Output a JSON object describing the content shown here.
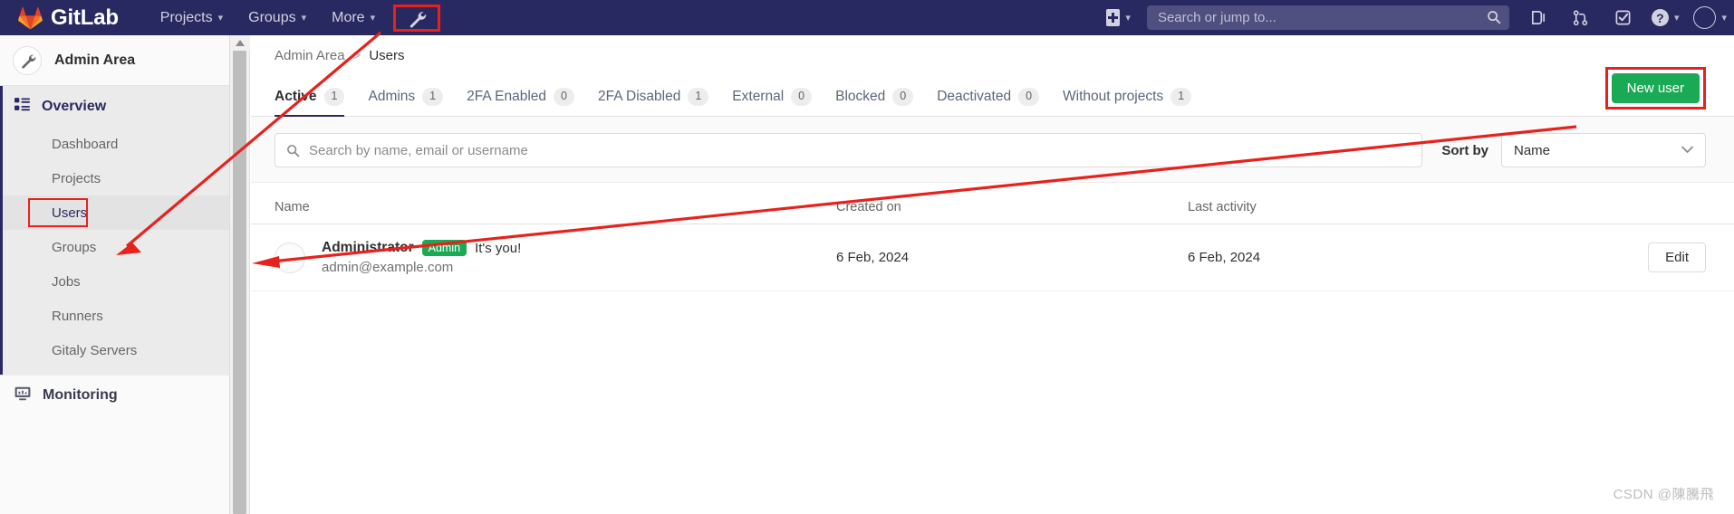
{
  "topnav": {
    "brand": "GitLab",
    "brand_logo_icon": "gitlab-tanuki-logo",
    "links": [
      {
        "label": "Projects",
        "icon": "chevron-down-icon"
      },
      {
        "label": "Groups",
        "icon": "chevron-down-icon"
      },
      {
        "label": "More",
        "icon": "chevron-down-icon"
      }
    ],
    "admin_wrench_icon": "wrench-icon",
    "create_new_icon": "plus-square-icon",
    "search": {
      "placeholder": "Search or jump to...",
      "value": "",
      "icon": "search-icon"
    },
    "right_icons": [
      {
        "name": "merge-requests-icon",
        "label": "Merge requests"
      },
      {
        "name": "issues-icon",
        "label": "Issues"
      },
      {
        "name": "todos-icon",
        "label": "To-Do List"
      }
    ],
    "help_icon": "question-circle-icon",
    "avatar_icon": "user-avatar"
  },
  "sidebar": {
    "title": "Admin Area",
    "title_icon": "wrench-icon",
    "section": {
      "label": "Overview",
      "icon": "overview-grid-icon",
      "items": [
        {
          "label": "Dashboard",
          "active": false
        },
        {
          "label": "Projects",
          "active": false
        },
        {
          "label": "Users",
          "active": true,
          "highlighted": true
        },
        {
          "label": "Groups",
          "active": false
        },
        {
          "label": "Jobs",
          "active": false
        },
        {
          "label": "Runners",
          "active": false
        },
        {
          "label": "Gitaly Servers",
          "active": false
        }
      ]
    },
    "bottom": {
      "label": "Monitoring",
      "icon": "monitor-icon"
    },
    "scrollbar_arrow_icon": "scroll-up-arrow-icon"
  },
  "breadcrumb": {
    "parent": "Admin Area",
    "separator": ">",
    "current": "Users"
  },
  "tabs": [
    {
      "label": "Active",
      "count": "1",
      "active": true
    },
    {
      "label": "Admins",
      "count": "1",
      "active": false
    },
    {
      "label": "2FA Enabled",
      "count": "0",
      "active": false
    },
    {
      "label": "2FA Disabled",
      "count": "1",
      "active": false
    },
    {
      "label": "External",
      "count": "0",
      "active": false
    },
    {
      "label": "Blocked",
      "count": "0",
      "active": false
    },
    {
      "label": "Deactivated",
      "count": "0",
      "active": false
    },
    {
      "label": "Without projects",
      "count": "1",
      "active": false
    }
  ],
  "new_user_button": {
    "label": "New user",
    "color": "#1aaa55"
  },
  "filter_bar": {
    "search": {
      "placeholder": "Search by name, email or username",
      "value": "",
      "icon": "search-icon"
    },
    "sort_label": "Sort by",
    "sort_value": "Name",
    "sort_caret_icon": "chevron-down-icon"
  },
  "table": {
    "columns": [
      "Name",
      "Created on",
      "Last activity",
      ""
    ],
    "rows": [
      {
        "name": "Administrator",
        "badge": "Admin",
        "its_you": "It's you!",
        "email": "admin@example.com",
        "created_on": "6 Feb, 2024",
        "last_activity": "6 Feb, 2024",
        "action": "Edit",
        "avatar_icon": "user-avatar"
      }
    ]
  },
  "annotation": {
    "color": "#e8211c"
  },
  "watermark": "CSDN @陳騰飛"
}
